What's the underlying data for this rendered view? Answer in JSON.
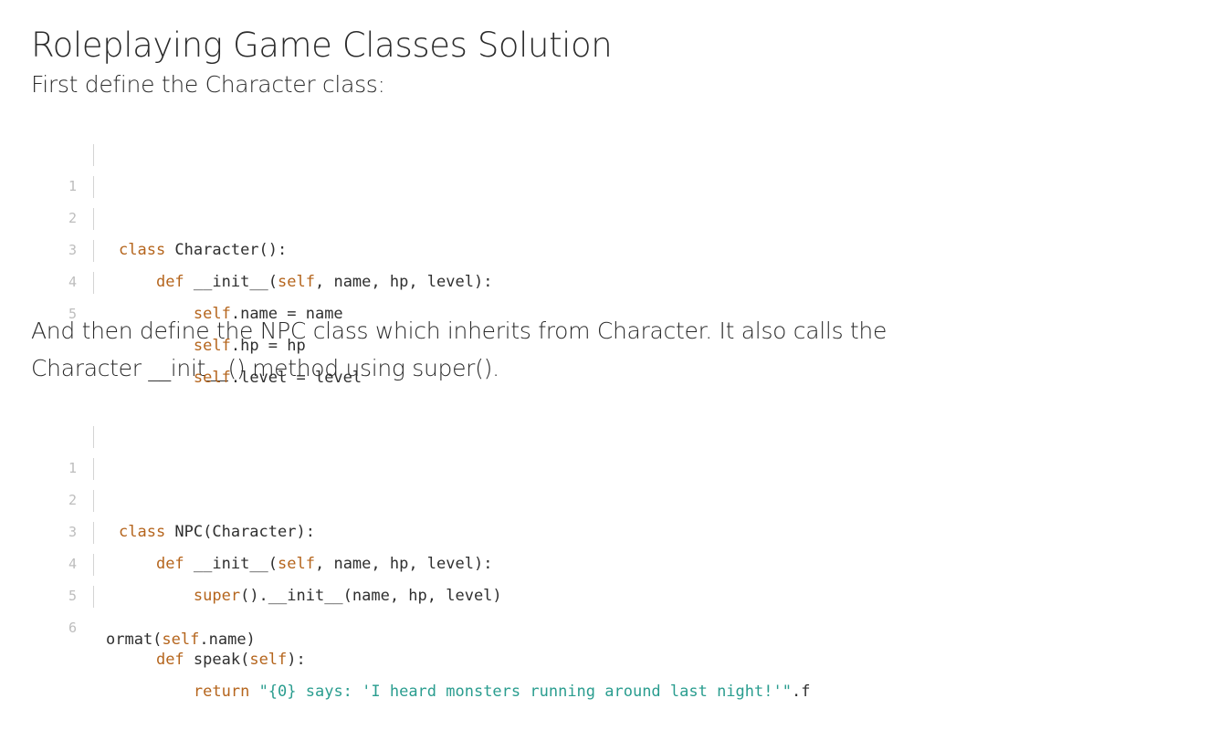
{
  "title": "Roleplaying Game Classes Solution",
  "intro": "First define the Character class:",
  "para2": "And then define the NPC class which inherits from Character.  It also calls the Character __init__() method using super().",
  "block1": {
    "line_numbers": [
      "1",
      "2",
      "3",
      "4",
      "5"
    ],
    "lines": {
      "l1": {
        "kw": "class",
        "rest": " Character():"
      },
      "l2": {
        "indent": "    ",
        "kw": "def",
        "mid": " __init__(",
        "kw2": "self",
        "rest": ", name, hp, level):"
      },
      "l3": {
        "indent": "        ",
        "kw": "self",
        "rest": ".name = name"
      },
      "l4": {
        "indent": "        ",
        "kw": "self",
        "rest": ".hp = hp"
      },
      "l5": {
        "indent": "        ",
        "kw": "self",
        "rest": ".level = level"
      }
    }
  },
  "block2": {
    "line_numbers": [
      "1",
      "2",
      "3",
      "4",
      "5",
      "6"
    ],
    "lines": {
      "l1": {
        "kw": "class",
        "rest": " NPC(Character):"
      },
      "l2": {
        "indent": "    ",
        "kw": "def",
        "mid": " __init__(",
        "kw2": "self",
        "rest": ", name, hp, level):"
      },
      "l3": {
        "indent": "        ",
        "kw": "super",
        "rest": "().__init__(name, hp, level)"
      },
      "l5": {
        "indent": "    ",
        "kw": "def",
        "mid": " speak(",
        "kw2": "self",
        "rest": "):"
      },
      "l6": {
        "indent": "        ",
        "kw": "return",
        "sp": " ",
        "str": "\"{0} says: 'I heard monsters running around last night!'\"",
        "rest": ".f"
      },
      "l6wrap": {
        "pre": "ormat(",
        "kw": "self",
        "rest": ".name)"
      }
    }
  }
}
